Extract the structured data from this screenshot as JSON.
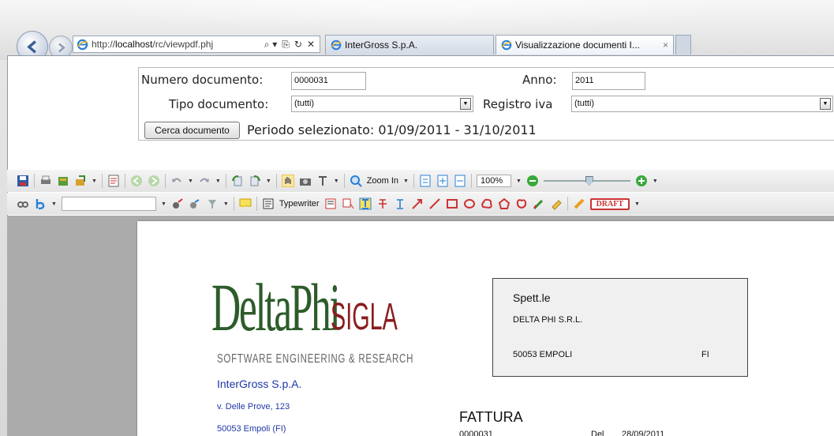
{
  "browser": {
    "address_url_prefix": "http://",
    "address_url_host": "localhost",
    "address_url_path": "/rc/viewpdf.phj",
    "address_tools": [
      "⌕ ▾",
      "⎘",
      "↻",
      "✕"
    ],
    "tabs": [
      {
        "label": "InterGross S.p.A."
      },
      {
        "label": "Visualizzazione documenti I..."
      }
    ],
    "tab_close": "×"
  },
  "form": {
    "numero_label": "Numero documento:",
    "numero_value": "0000031",
    "anno_label": "Anno:",
    "anno_value": "2011",
    "tipo_label": "Tipo documento:",
    "tipo_value": "(tutti)",
    "registro_label": "Registro iva",
    "registro_value": "(tutti)",
    "search_button": "Cerca documento",
    "period_text": "Periodo selezionato: 01/09/2011 - 31/10/2011"
  },
  "toolbar": {
    "zoom_in_label": "Zoom In",
    "zoom_value": "100%",
    "typewriter_label": "Typewriter",
    "draft_label": "DRAFT",
    "icons_row1": [
      "save-icon",
      "print-icon",
      "export-icon",
      "share-icon",
      "properties-icon",
      "back-icon",
      "forward-icon",
      "undo-icon",
      "redo-icon",
      "rotate-left-icon",
      "rotate-right-icon",
      "hand-tool-icon",
      "snapshot-icon",
      "select-text-icon",
      "zoom-in-icon",
      "actual-size-icon",
      "fit-page-icon",
      "fit-width-icon",
      "zoom-out-icon",
      "zoom-plus-icon"
    ],
    "icons_row2": [
      "link-icon",
      "text-style-icon",
      "stamp-icon",
      "attach-icon",
      "highlight-icon",
      "note-icon",
      "typewriter-icon",
      "textbox-icon",
      "callout-icon",
      "text-underline-icon",
      "strikethrough-icon",
      "insert-text-icon",
      "arrow-icon",
      "line-icon",
      "rectangle-icon",
      "oval-icon",
      "cloud-icon",
      "polygon-icon",
      "polyline-icon",
      "pencil-icon",
      "eraser-icon",
      "stamp-draft-icon"
    ]
  },
  "document": {
    "logo_main": "DeltaPhi",
    "logo_sigla": "SIGLA",
    "logo_subtitle": "SOFTWARE ENGINEERING & RESEARCH",
    "sender_name": "InterGross S.p.A.",
    "sender_address": "v. Delle Prove, 123",
    "sender_city": "50053 Empoli (FI)",
    "recipient_heading": "Spett.le",
    "recipient_name": "DELTA PHI S.R.L.",
    "recipient_city": "50053  EMPOLI",
    "recipient_prov": "FI",
    "doc_type": "FATTURA",
    "doc_number": "0000031",
    "doc_del_label": "Del",
    "doc_date": "28/09/2011"
  },
  "colors": {
    "accent_blue": "#1f37a8",
    "logo_green": "#2d5c2b",
    "logo_red": "#8a1c1f",
    "draft_red": "#cc3333"
  }
}
